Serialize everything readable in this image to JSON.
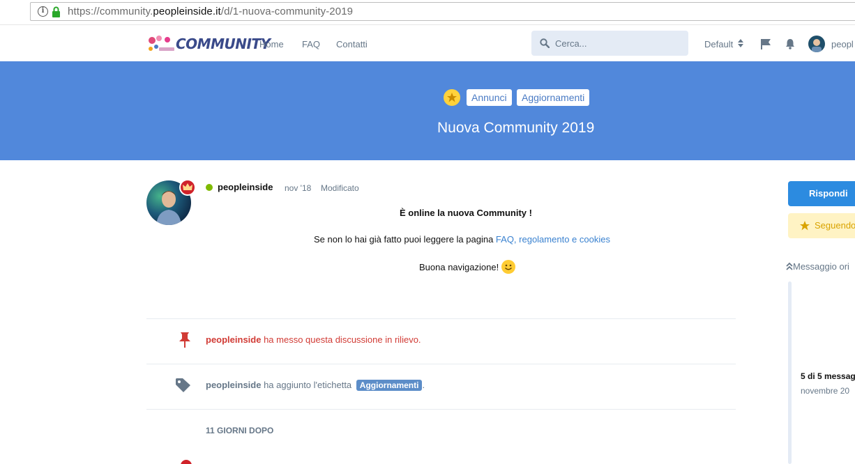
{
  "browser": {
    "url_prefix": "https://community.",
    "url_domain": "peopleinside.it",
    "url_path": "/d/1-nuova-community-2019"
  },
  "header": {
    "logo_text": "COMMUNITY",
    "nav": [
      "Home",
      "FAQ",
      "Contatti"
    ],
    "search_placeholder": "Cerca...",
    "language": "Default",
    "username": "peopl"
  },
  "hero": {
    "tags": [
      "Annunci",
      "Aggiornamenti"
    ],
    "title": "Nuova Community 2019"
  },
  "post": {
    "user": "peopleinside",
    "date": "nov '18",
    "edited": "Modificato",
    "title": "È online la nuova Community !",
    "line2_text": "Se non lo hai già fatto puoi leggere la pagina ",
    "line2_link": "FAQ, regolamento e cookies",
    "line3": "Buona navigazione!"
  },
  "events": [
    {
      "user": "peopleinside",
      "text": " ha messo questa discussione in rilievo.",
      "icon": "pin-icon"
    },
    {
      "user": "peopleinside",
      "text": " ha aggiunto l'etichetta ",
      "tag": "Aggiornamenti",
      "suffix": ".",
      "icon": "tag-icon"
    }
  ],
  "time_gap": "11 GIORNI DOPO",
  "sidebar": {
    "reply": "Rispondi",
    "follow": "Seguendo",
    "original": "Messaggio ori",
    "count": "5 di 5 messag",
    "date": "novembre 20"
  },
  "colors": {
    "hero": "#5188db",
    "accent": "#2c8be0",
    "event_red": "#d13b35"
  }
}
